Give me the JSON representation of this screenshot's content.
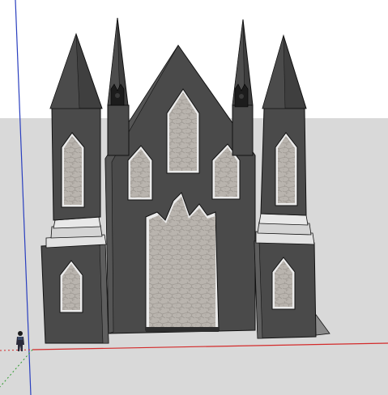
{
  "app": {
    "view": "3d-model-viewport"
  },
  "colors": {
    "sky": "#ffffff",
    "ground": "#d9d9d9",
    "wall_dark": "#4a4a4a",
    "wall_mid": "#5a5a5a",
    "wall_light": "#6a6a6a",
    "roof_dark": "#3f3f3f",
    "window_fill": "#b9b4ae",
    "window_frame": "#e6e6e6",
    "band": "#e2e2e2",
    "outline": "#111111",
    "axis_blue": "#2a3fbf",
    "axis_red": "#d32a2a",
    "axis_green": "#2f9b2f"
  },
  "model": {
    "subject": "gothic-castle-facade",
    "figure": "scale-figure-person",
    "statues": [
      "gargoyle-statue-left",
      "gargoyle-statue-right"
    ]
  }
}
